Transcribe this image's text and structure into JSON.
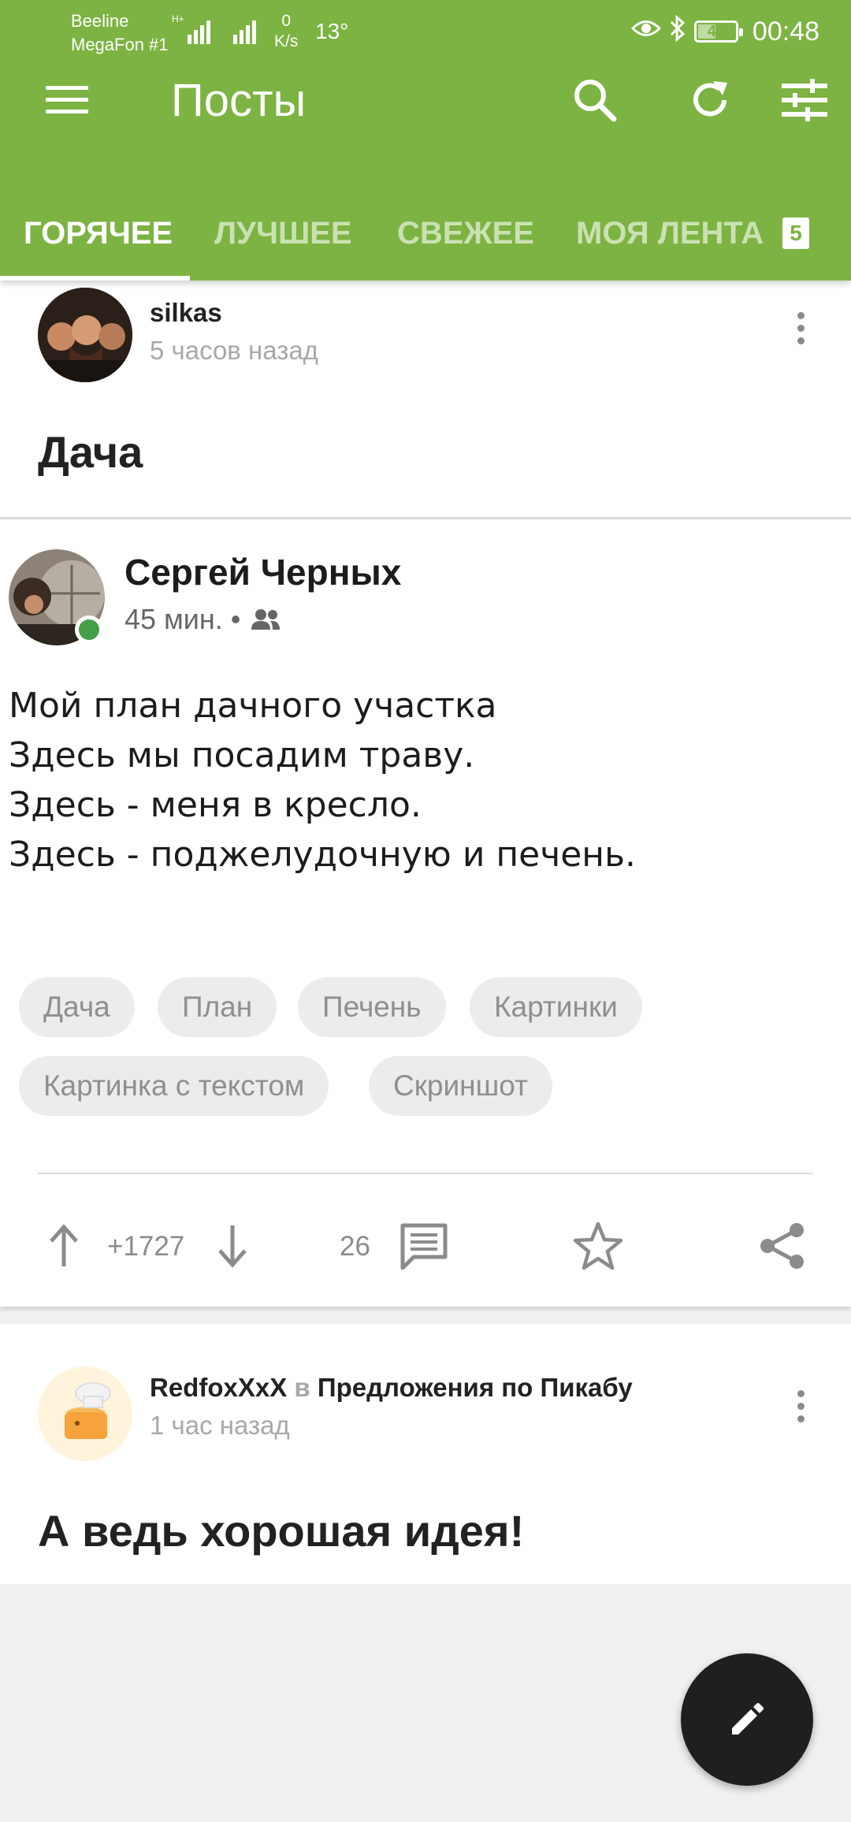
{
  "status_bar": {
    "carrier_1": "Beeline",
    "carrier_2": "MegaFon #1",
    "net_type": "H+",
    "speed_value": "0",
    "speed_unit": "K/s",
    "temperature": "13°",
    "battery": "44",
    "battery_level_percent": 44,
    "time": "00:48",
    "icons": [
      "eye-icon",
      "bluetooth-icon",
      "battery-icon"
    ]
  },
  "toolbar": {
    "title": "Посты",
    "icons": [
      "menu-icon",
      "search-icon",
      "refresh-icon",
      "filter-icon"
    ]
  },
  "tabs": [
    {
      "label": "ГОРЯЧЕЕ",
      "active": true
    },
    {
      "label": "ЛУЧШЕЕ",
      "active": false
    },
    {
      "label": "СВЕЖЕЕ",
      "active": false
    },
    {
      "label": "МОЯ ЛЕНТА",
      "active": false,
      "badge": "5"
    }
  ],
  "posts": [
    {
      "author": "silkas",
      "time": "5 часов назад",
      "title": "Дача",
      "embed": {
        "author": "Сергей Черных",
        "time": "45 мин. •",
        "lines": [
          "Мой план дачного участка",
          "Здесь мы посадим траву.",
          "Здесь - меня в кресло.",
          "Здесь - поджелудочную и печень."
        ]
      },
      "tags": [
        "Дача",
        "План",
        "Печень",
        "Картинки",
        "Картинка с текстом",
        "Скриншот"
      ],
      "rating": "+1727",
      "comments": "26"
    },
    {
      "author": "RedfoxXxX",
      "in_word": "в",
      "community": "Предложения по Пикабу",
      "time": "1 час назад",
      "title": "А ведь хорошая идея!"
    }
  ],
  "colors": {
    "brand_green": "#7cb342",
    "fab": "#1f1f1f",
    "online_dot": "#43a047"
  }
}
